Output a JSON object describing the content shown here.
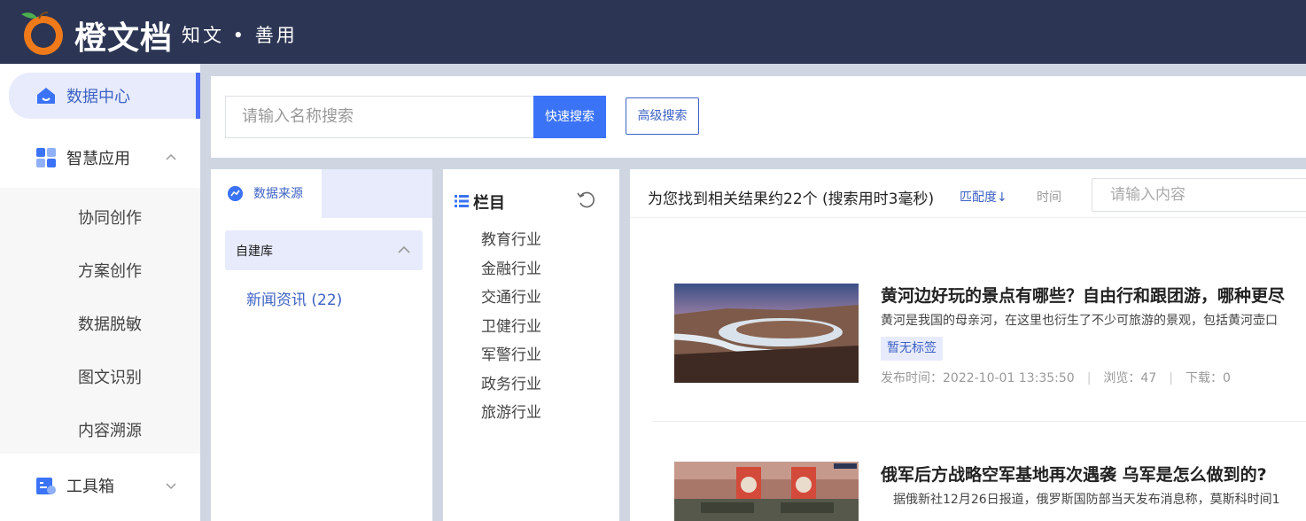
{
  "brand": {
    "name": "橙文档",
    "slogan": "知文 • 善用",
    "colors": {
      "header_bg": "#2c3553",
      "accent": "#3b73f7",
      "logo_orange": "#f07a1a"
    }
  },
  "sidebar": {
    "items": [
      {
        "label": "数据中心",
        "icon": "home-icon",
        "active": true
      },
      {
        "label": "智慧应用",
        "icon": "apps-grid-icon",
        "expanded": true
      },
      {
        "label": "工具箱",
        "icon": "toolbox-icon",
        "expanded": false
      }
    ],
    "sub_items": [
      "协同创作",
      "方案创作",
      "数据脱敏",
      "图文识别",
      "内容溯源"
    ]
  },
  "search": {
    "placeholder": "请输入名称搜索",
    "quick_label": "快速搜索",
    "advanced_label": "高级搜索"
  },
  "source": {
    "tab_label": "数据来源",
    "library_label": "自建库",
    "child_label": "新闻资讯 (22)"
  },
  "categories": {
    "title": "栏目",
    "items": [
      "教育行业",
      "金融行业",
      "交通行业",
      "卫健行业",
      "军警行业",
      "政务行业",
      "旅游行业"
    ]
  },
  "results": {
    "summary": "为您找到相关结果约22个 (搜索用时3毫秒)",
    "sort_relevance": "匹配度↓",
    "sort_time": "时间",
    "filter_placeholder": "请输入内容",
    "items": [
      {
        "title": "黄河边好玩的景点有哪些？自由行和跟团游，哪种更尽",
        "summary": "黄河是我国的母亲河，在这里也衍生了不少可旅游的景观，包括黄河壶口",
        "tag": "暂无标签",
        "published": "发布时间：2022-10-01 13:35:50",
        "views": "浏览：47",
        "downloads": "下载：0"
      },
      {
        "title": "俄军后方战略空军基地再次遇袭 乌军是怎么做到的?",
        "summary": "据俄新社12月26日报道，俄罗斯国防部当天发布消息称，莫斯科时间1"
      }
    ]
  }
}
